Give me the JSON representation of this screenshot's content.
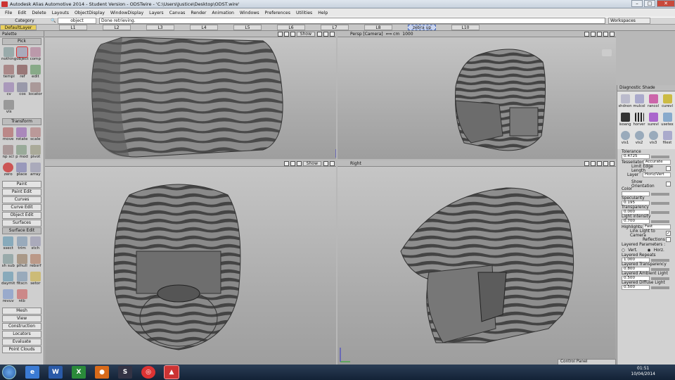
{
  "window": {
    "title": "Autodesk Alias Automotive 2014  - Student Version  - ODSTwire - 'C:\\Users\\Justice\\Desktop\\ODST.wire'"
  },
  "menu": [
    "File",
    "Edit",
    "Delete",
    "Layouts",
    "ObjectDisplay",
    "WindowDisplay",
    "Layers",
    "Canvas",
    "Render",
    "Animation",
    "Windows",
    "Preferences",
    "Utilities",
    "Help"
  ],
  "control": {
    "category_label": "Category",
    "category_value": "object",
    "message": "Done retrieving.",
    "workspaces": "Workspaces"
  },
  "layers": {
    "default": "DefaultLayer",
    "items": [
      "L1",
      "L2",
      "L3",
      "L4",
      "L5",
      "L6",
      "L7",
      "L8",
      "zebra up",
      "L10"
    ]
  },
  "palette": {
    "title": "Palette",
    "pick_header": "Pick",
    "pick_tools": [
      "nothing",
      "object",
      "comp",
      "templ",
      "ref",
      "edit",
      "cv",
      "cos",
      "locator",
      "vis"
    ],
    "transform_header": "Transform",
    "transform_tools": [
      "move",
      "rotate",
      "scale",
      "np scl",
      "p mod",
      "pivot",
      "zero",
      "place",
      "array"
    ],
    "sections_mid": [
      "Paint",
      "Paint Edit",
      "Curves",
      "Curve Edit",
      "Object Edit",
      "Surfaces",
      "Surface Edit"
    ],
    "surf_tools": [
      "ssect",
      "trim",
      "stch",
      "sh sub",
      "plhull",
      "rebsrf",
      "daymit",
      "fitscn",
      "setor",
      "revuv",
      "ntb"
    ],
    "sections_bottom": [
      "Mesh",
      "View",
      "Construction",
      "Locators",
      "Evaluate",
      "Point Clouds"
    ]
  },
  "views": {
    "top_show": "Show",
    "persp_label": "Persp [Camera]",
    "persp_zoom": "1000",
    "front_show": "Show",
    "right_label": "Right"
  },
  "diagnostic": {
    "title": "Diagnostic Shade",
    "tools": [
      "shdnon",
      "mulcol",
      "rancol",
      "curevl",
      "isoang",
      "horver",
      "surevl",
      "usetex",
      "vis1",
      "vis2",
      "vis3",
      "filest"
    ],
    "tolerance_label": "Tolerance",
    "tolerance": "0.4725",
    "tessellator_label": "Tessellator",
    "tessellator": "Accurate",
    "limit_edge": "Limit Edge Length",
    "layer_label": "Layer",
    "layer": "Horiz/Vert",
    "show_orient": "Show Orientation",
    "color_label": "Color",
    "specularity_label": "Specularity",
    "specularity": "0.195",
    "transparency_label": "Transparency",
    "transparency": "0.000",
    "light_label": "Light intensity",
    "light": "0.700",
    "highlights_label": "Highlights",
    "highlights": "Fast",
    "link_light": "Link Light to Camera",
    "reflections": "Reflections",
    "layered_params": "Layered Parameters :",
    "vert": "Vert.",
    "horz": "Horz.",
    "lr_label": "Layered Repeats",
    "lr": "1.000",
    "lt_label": "Layered Transparency",
    "lt": "0.800",
    "la_label": "Layered Ambient Light",
    "la": "0.500",
    "ld_label": "Layered Diffuse Light",
    "ld": "0.500"
  },
  "control_panel": "Control Panel",
  "clock": {
    "time": "01:51",
    "date": "10/04/2014"
  },
  "taskbar": [
    "ie",
    "word",
    "excel",
    "media",
    "steam",
    "chrome",
    "alias"
  ]
}
